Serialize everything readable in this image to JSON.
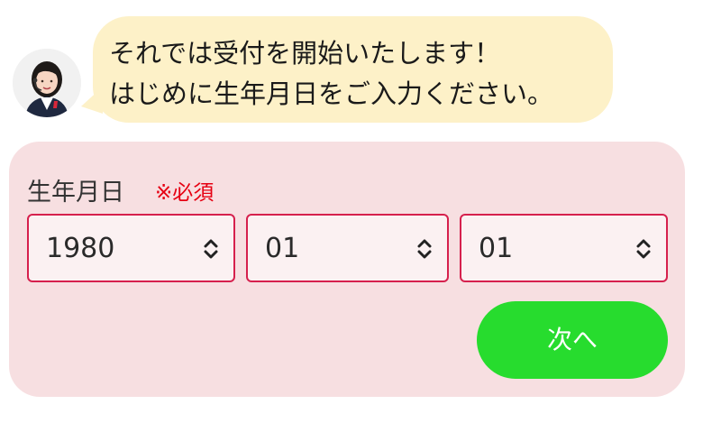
{
  "operator": {
    "avatar_icon": "operator-avatar-icon"
  },
  "message": {
    "line1": "それでは受付を開始いたします！",
    "line2": "はじめに生年月日をご入力ください。"
  },
  "form": {
    "label": "生年月日",
    "required": "※必須",
    "year": {
      "value": "1980",
      "icon": "updown-chevron-icon"
    },
    "month": {
      "value": "01",
      "icon": "updown-chevron-icon"
    },
    "day": {
      "value": "01",
      "icon": "updown-chevron-icon"
    },
    "next_label": "次へ"
  },
  "colors": {
    "bubble": "#fdf1c8",
    "panel": "#f7dfe1",
    "select_border": "#d6204d",
    "required": "#e60012",
    "next_button": "#27dc2e"
  }
}
